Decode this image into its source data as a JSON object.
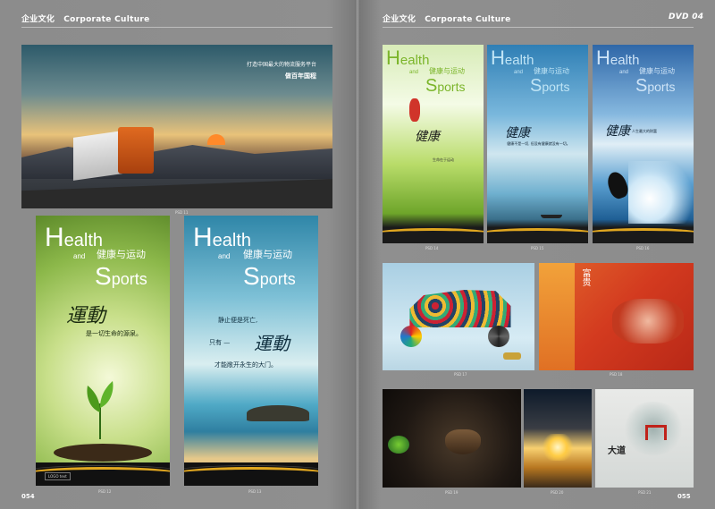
{
  "left_header": {
    "cn": "企业文化",
    "en": "Corporate Culture"
  },
  "right_header": {
    "cn": "企业文化",
    "en": "Corporate Culture",
    "badge": "DVD 04"
  },
  "page_numbers": {
    "left": "054",
    "right": "055"
  },
  "truck_poster": {
    "line1": "打造中国最大的物流服务平台",
    "line2": "做百年国程",
    "caption": "PSD 11"
  },
  "green_poster": {
    "title_h": "H",
    "title_rest": "ealth",
    "and": "and",
    "cn": "健康与运动",
    "sports_s": "S",
    "sports_rest": "ports",
    "calligraphy": "運動",
    "tagline": "是一切生命的源泉。",
    "logo": "LOGO text",
    "caption": "PSD 12"
  },
  "sea_poster": {
    "title_h": "H",
    "title_rest": "ealth",
    "and": "and",
    "cn": "健康与运动",
    "sports_s": "S",
    "sports_rest": "ports",
    "line1": "静止便是死亡,",
    "line2_pre": "只有 —",
    "calligraphy": "運動",
    "line3": "才能敞开永生的大门。",
    "caption": "PSD 13"
  },
  "small_posters": [
    {
      "title_h": "H",
      "title_rest": "ealth",
      "and": "and",
      "cn": "健康与运动",
      "sports_s": "S",
      "sports_rest": "ports",
      "calligraphy": "健康",
      "text": "生命在于运动",
      "caption": "PSD 14"
    },
    {
      "title_h": "H",
      "title_rest": "ealth",
      "and": "and",
      "cn": "健康与运动",
      "sports_s": "S",
      "sports_rest": "ports",
      "calligraphy": "健康",
      "text": "健康不是一切, 但没有健康就没有一切。",
      "caption": "PSD 15"
    },
    {
      "title_h": "H",
      "title_rest": "ealth",
      "and": "and",
      "cn": "健康与运动",
      "sports_s": "S",
      "sports_rest": "ports",
      "calligraphy": "健康",
      "text": "人生最大的财富",
      "caption": "PSD 16"
    }
  ],
  "mid_row": [
    {
      "caption": "PSD 17"
    },
    {
      "calligraphy": "富贵",
      "caption": "PSD 18"
    }
  ],
  "bottom_row": [
    {
      "caption": "PSD 19"
    },
    {
      "caption": "PSD 20"
    },
    {
      "calligraphy": "大道",
      "caption": "PSD 21"
    }
  ],
  "colors": {
    "accent_gold": "#e1a720",
    "page_bg": "#8c8c8c"
  }
}
